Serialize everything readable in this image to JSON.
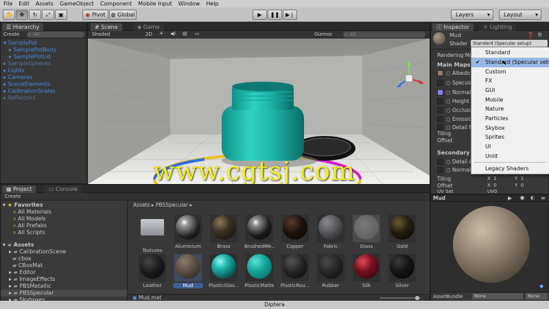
{
  "menu": [
    "File",
    "Edit",
    "Assets",
    "GameObject",
    "Component",
    "Mobile Input",
    "Window",
    "Help"
  ],
  "toolbar": {
    "pivot": "Pivot",
    "global": "Global",
    "layers": "Layers",
    "layout": "Layout"
  },
  "hierarchy": {
    "tab": "Hierarchy",
    "create": "Create",
    "search": "All",
    "items": [
      "SamplePot",
      "SamplePotBody",
      "SamplePotLid",
      "SampleSpheres",
      "Lights",
      "Cameras",
      "SceneElements",
      "CalibrationScales",
      "Reflectors"
    ]
  },
  "scene": {
    "tab_scene": "Scene",
    "tab_game": "Game",
    "shaded": "Shaded",
    "mode_2d": "2D",
    "gizmos": "Gizmos",
    "search": "All",
    "watermark": "www.cgtsj.com"
  },
  "inspector": {
    "tab": "Inspector",
    "tab2": "Lighting",
    "material": "Mud",
    "shader_label": "Shader",
    "shader_value": "Standard (Specular setup)",
    "rendering_mode": "Rendering Mo",
    "main_maps": "Main Maps",
    "rows": [
      "Albedo",
      "Specular",
      "Normal M",
      "Height M",
      "Occlusio",
      "Emission",
      "Detail M"
    ],
    "tiling": "Tiling",
    "offset": "Offset",
    "secondary": "Secondary M",
    "secondary_rows": [
      "Detail Al",
      "Normal M"
    ],
    "tiling2": "Tiling",
    "offset2": "Offset",
    "uvset": "UV Set",
    "uvset_value": "UV0",
    "x1": "1",
    "y1": "1",
    "x0": "0",
    "y0": "0",
    "x_label": "X",
    "y_label": "Y",
    "preview_name": "Mud",
    "assetbundle": "AssetBundle",
    "none1": "None",
    "none2": "None"
  },
  "shader_menu": {
    "items": [
      "Standard",
      "Standard (Specular setup)",
      "Custom",
      "FX",
      "GUI",
      "Mobile",
      "Nature",
      "Particles",
      "Skybox",
      "Sprites",
      "UI",
      "Unlit",
      "Legacy Shaders"
    ],
    "checked_index": 1
  },
  "project": {
    "tab": "Project",
    "tab2": "Console",
    "create": "Create",
    "favorites": "Favorites",
    "fav_items": [
      "All Materials",
      "All Models",
      "All Prefabs",
      "All Scripts"
    ],
    "assets": "Assets",
    "asset_folders": [
      "CalibrationScene",
      "cbox",
      "CBoxMat",
      "Editor",
      "ImageEffects",
      "PBSMetallic",
      "PBSSpecular",
      "Skyboxes"
    ],
    "breadcrumb_root": "Assets",
    "breadcrumb_leaf": "PBSSpecular",
    "grid_row1": [
      "Textures",
      "Aluminium",
      "Brass",
      "BrushedMe...",
      "Copper",
      "Fabric",
      "Glass",
      "Gold"
    ],
    "grid_row2": [
      "Leather",
      "Mud",
      "PlasticGlos...",
      "PlasticMatte",
      "PlasticRou...",
      "Rubber",
      "Silk",
      "Silver"
    ],
    "selected_file": "Mud.mat"
  },
  "caption": "Diptera"
}
